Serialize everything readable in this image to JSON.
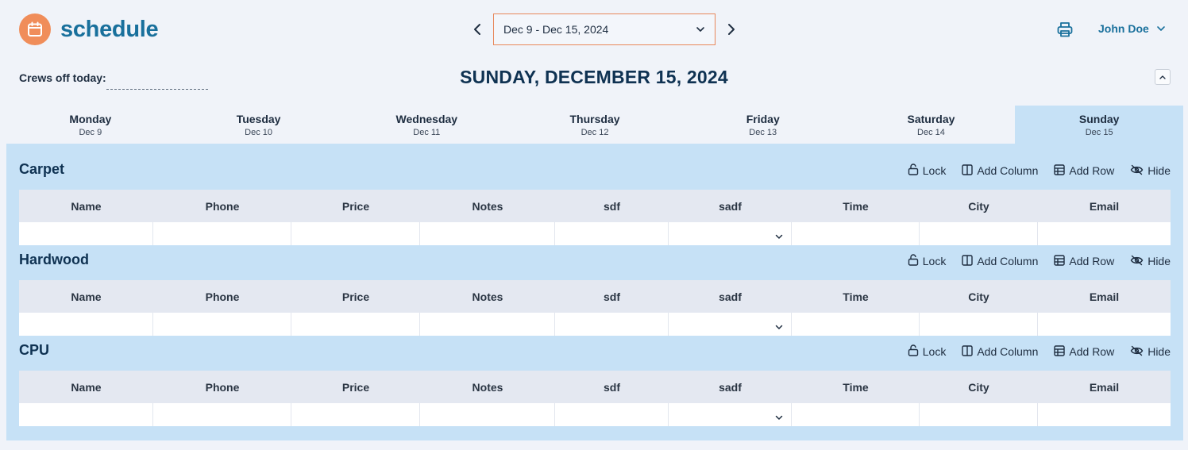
{
  "app": {
    "title": "schedule",
    "logo_icon": "calendar-icon",
    "accent": "#f08d5a",
    "brand_color": "#19709c"
  },
  "week": {
    "selected": "Dec 9 - Dec 15, 2024",
    "prev_icon": "chevron-left-icon",
    "next_icon": "chevron-right-icon"
  },
  "user": {
    "name": "John Doe"
  },
  "crews": {
    "label": "Crews off today:"
  },
  "heading": "SUNDAY, DECEMBER 15, 2024",
  "tabs": [
    {
      "day": "Monday",
      "date": "Dec 9",
      "active": false
    },
    {
      "day": "Tuesday",
      "date": "Dec 10",
      "active": false
    },
    {
      "day": "Wednesday",
      "date": "Dec 11",
      "active": false
    },
    {
      "day": "Thursday",
      "date": "Dec 12",
      "active": false
    },
    {
      "day": "Friday",
      "date": "Dec 13",
      "active": false
    },
    {
      "day": "Saturday",
      "date": "Dec 14",
      "active": false
    },
    {
      "day": "Sunday",
      "date": "Dec 15",
      "active": true
    }
  ],
  "actions": {
    "lock": "Lock",
    "add_column": "Add Column",
    "add_row": "Add Row",
    "hide": "Hide"
  },
  "columns": [
    "Name",
    "Phone",
    "Price",
    "Notes",
    "sdf",
    "sadf",
    "Time",
    "City",
    "Email"
  ],
  "sections": [
    {
      "title": "Carpet"
    },
    {
      "title": "Hardwood"
    },
    {
      "title": "CPU"
    }
  ]
}
